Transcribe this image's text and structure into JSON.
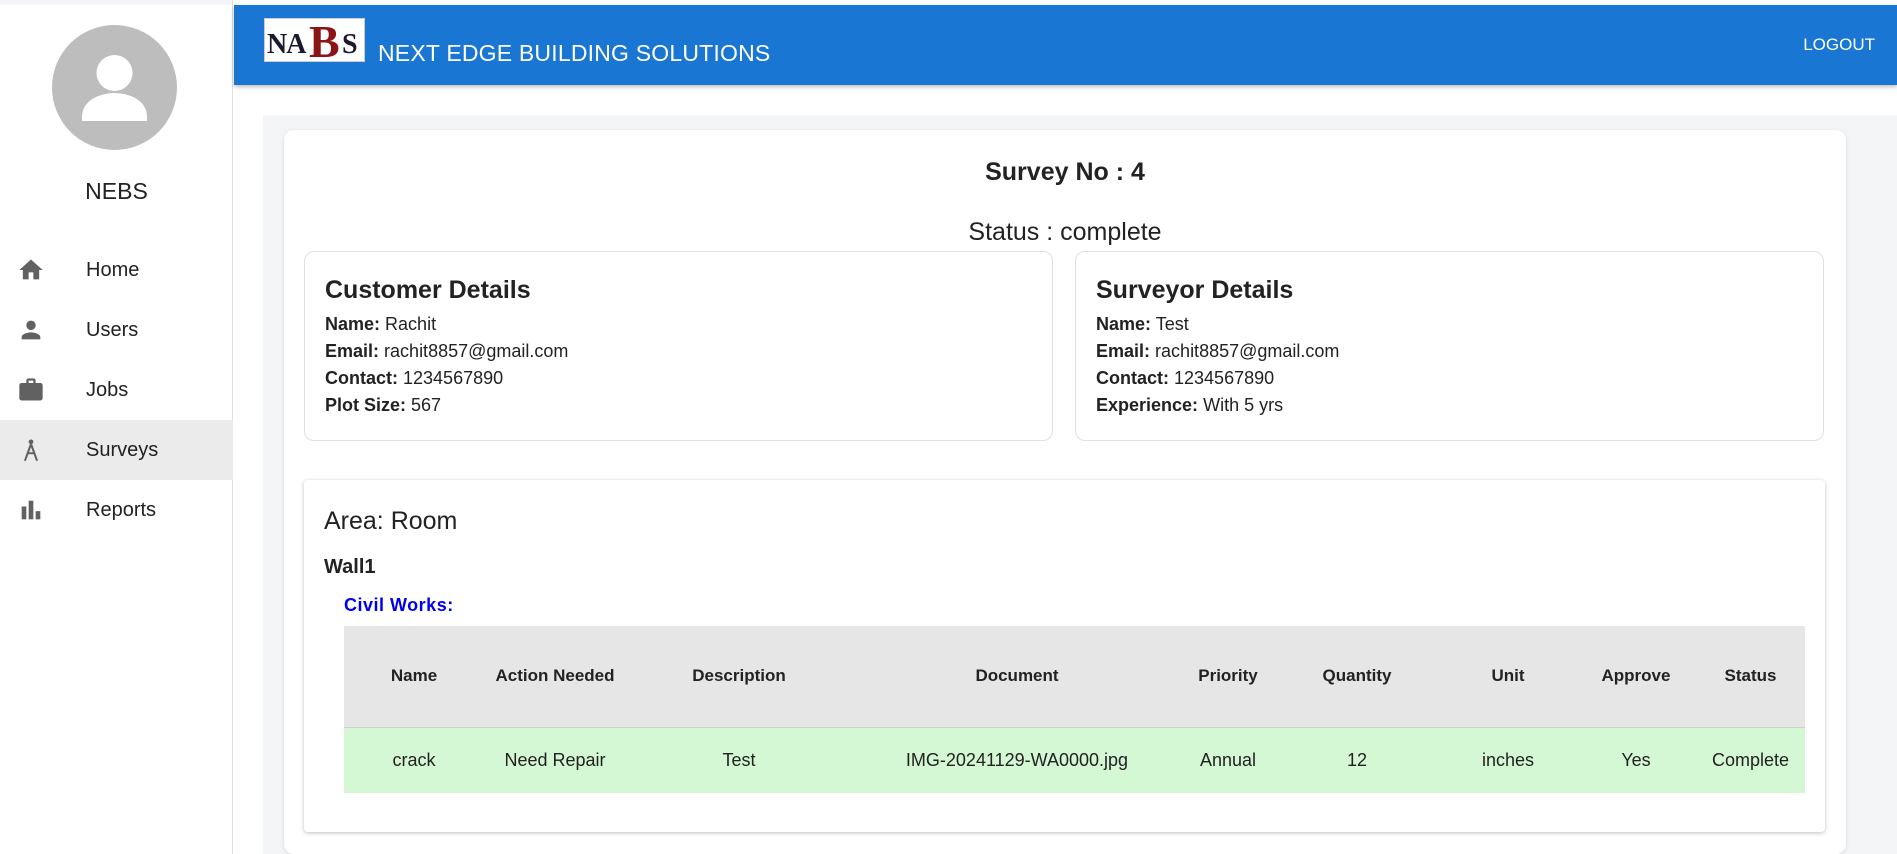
{
  "sidebar": {
    "brand": "NEBS",
    "items": [
      {
        "label": "Home",
        "icon": "home-icon"
      },
      {
        "label": "Users",
        "icon": "person-icon"
      },
      {
        "label": "Jobs",
        "icon": "briefcase-icon"
      },
      {
        "label": "Surveys",
        "icon": "compass-icon",
        "active": true
      },
      {
        "label": "Reports",
        "icon": "bar-chart-icon"
      }
    ]
  },
  "header": {
    "logo_text": {
      "na": "NA",
      "b": "B",
      "s": "S"
    },
    "title": "NEXT EDGE BUILDING SOLUTIONS",
    "logout_label": "LOGOUT",
    "color": "#1976d2"
  },
  "survey": {
    "number_line": "Survey No : 4",
    "status_line": "Status : complete"
  },
  "customer": {
    "title": "Customer Details",
    "rows": [
      {
        "key": "Name:",
        "value": "Rachit"
      },
      {
        "key": "Email:",
        "value": "rachit8857@gmail.com"
      },
      {
        "key": "Contact:",
        "value": "1234567890"
      },
      {
        "key": "Plot Size:",
        "value": "567"
      }
    ]
  },
  "surveyor": {
    "title": "Surveyor Details",
    "rows": [
      {
        "key": "Name:",
        "value": "Test"
      },
      {
        "key": "Email:",
        "value": "rachit8857@gmail.com"
      },
      {
        "key": "Contact:",
        "value": "1234567890"
      },
      {
        "key": "Experience:",
        "value": "With 5 yrs"
      }
    ]
  },
  "area": {
    "title": "Area: Room",
    "wall": "Wall1",
    "category": "Civil Works:",
    "columns": [
      "Name",
      "Action Needed",
      "Description",
      "Document",
      "Priority",
      "Quantity",
      "Unit",
      "Approve",
      "Status"
    ],
    "rows": [
      [
        "crack",
        "Need Repair",
        "Test",
        "IMG-20241129-WA0000.jpg",
        "Annual",
        "12",
        "inches",
        "Yes",
        "Complete"
      ]
    ],
    "row_color": "#d4f7d4"
  }
}
